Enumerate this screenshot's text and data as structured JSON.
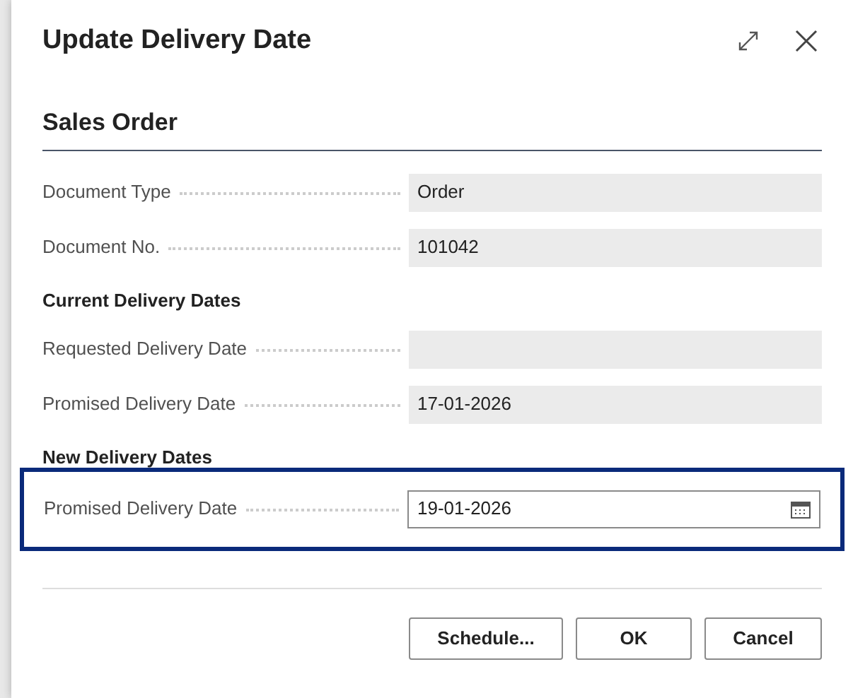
{
  "dialog": {
    "title": "Update Delivery Date"
  },
  "section": {
    "title": "Sales Order"
  },
  "rows": [
    {
      "kind": "field",
      "label": "Document Type",
      "value": "Order",
      "editable": false,
      "highlighted": false
    },
    {
      "kind": "field",
      "label": "Document No.",
      "value": "101042",
      "editable": false,
      "highlighted": false
    },
    {
      "kind": "heading",
      "label": "Current Delivery Dates"
    },
    {
      "kind": "field",
      "label": "Requested Delivery Date",
      "value": "",
      "editable": false,
      "highlighted": false
    },
    {
      "kind": "field",
      "label": "Promised Delivery Date",
      "value": "17-01-2026",
      "editable": false,
      "highlighted": false
    },
    {
      "kind": "heading",
      "label": "New Delivery Dates"
    },
    {
      "kind": "field",
      "label": "Promised Delivery Date",
      "value": "19-01-2026",
      "editable": true,
      "highlighted": true
    }
  ],
  "buttons": [
    "Schedule...",
    "OK",
    "Cancel"
  ]
}
